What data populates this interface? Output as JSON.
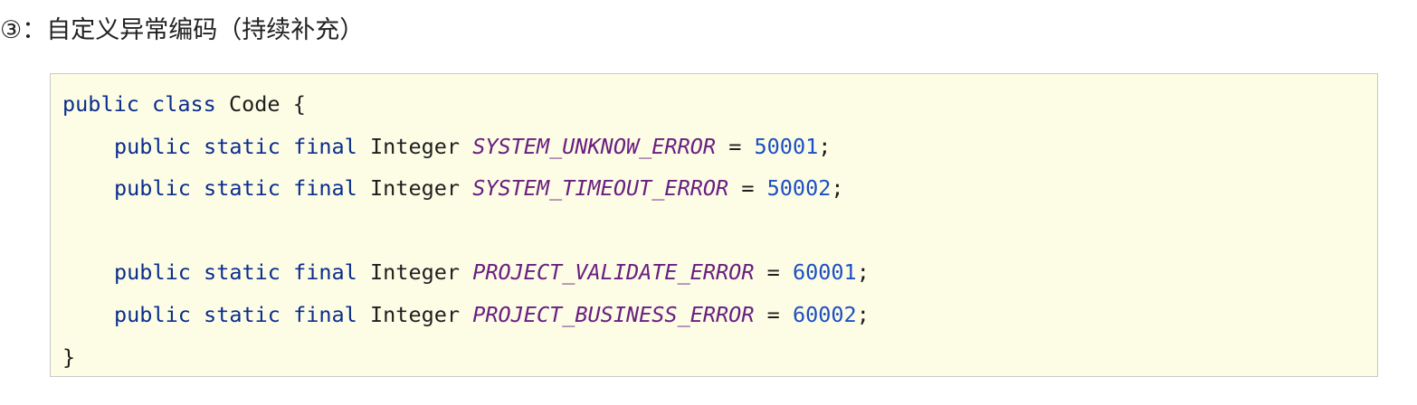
{
  "heading": {
    "text": "③：自定义异常编码（持续补充）"
  },
  "code": {
    "language": "java",
    "line1": {
      "kw_public": "public",
      "kw_class": "class",
      "class_name": "Code",
      "brace_open": "{"
    },
    "fields": [
      {
        "kw_public": "public",
        "kw_static": "static",
        "kw_final": "final",
        "type": "Integer",
        "name": "SYSTEM_UNKNOW_ERROR",
        "eq": "=",
        "value": "50001",
        "semi": ";"
      },
      {
        "kw_public": "public",
        "kw_static": "static",
        "kw_final": "final",
        "type": "Integer",
        "name": "SYSTEM_TIMEOUT_ERROR",
        "eq": "=",
        "value": "50002",
        "semi": ";"
      },
      {
        "kw_public": "public",
        "kw_static": "static",
        "kw_final": "final",
        "type": "Integer",
        "name": "PROJECT_VALIDATE_ERROR",
        "eq": "=",
        "value": "60001",
        "semi": ";"
      },
      {
        "kw_public": "public",
        "kw_static": "static",
        "kw_final": "final",
        "type": "Integer",
        "name": "PROJECT_BUSINESS_ERROR",
        "eq": "=",
        "value": "60002",
        "semi": ";"
      }
    ],
    "brace_close": "}"
  },
  "colors": {
    "keyword": "#0b2d8c",
    "constant": "#6a1f80",
    "number": "#1c4fc2",
    "code_background": "#fdfde6",
    "code_border": "#c9c9c9"
  }
}
